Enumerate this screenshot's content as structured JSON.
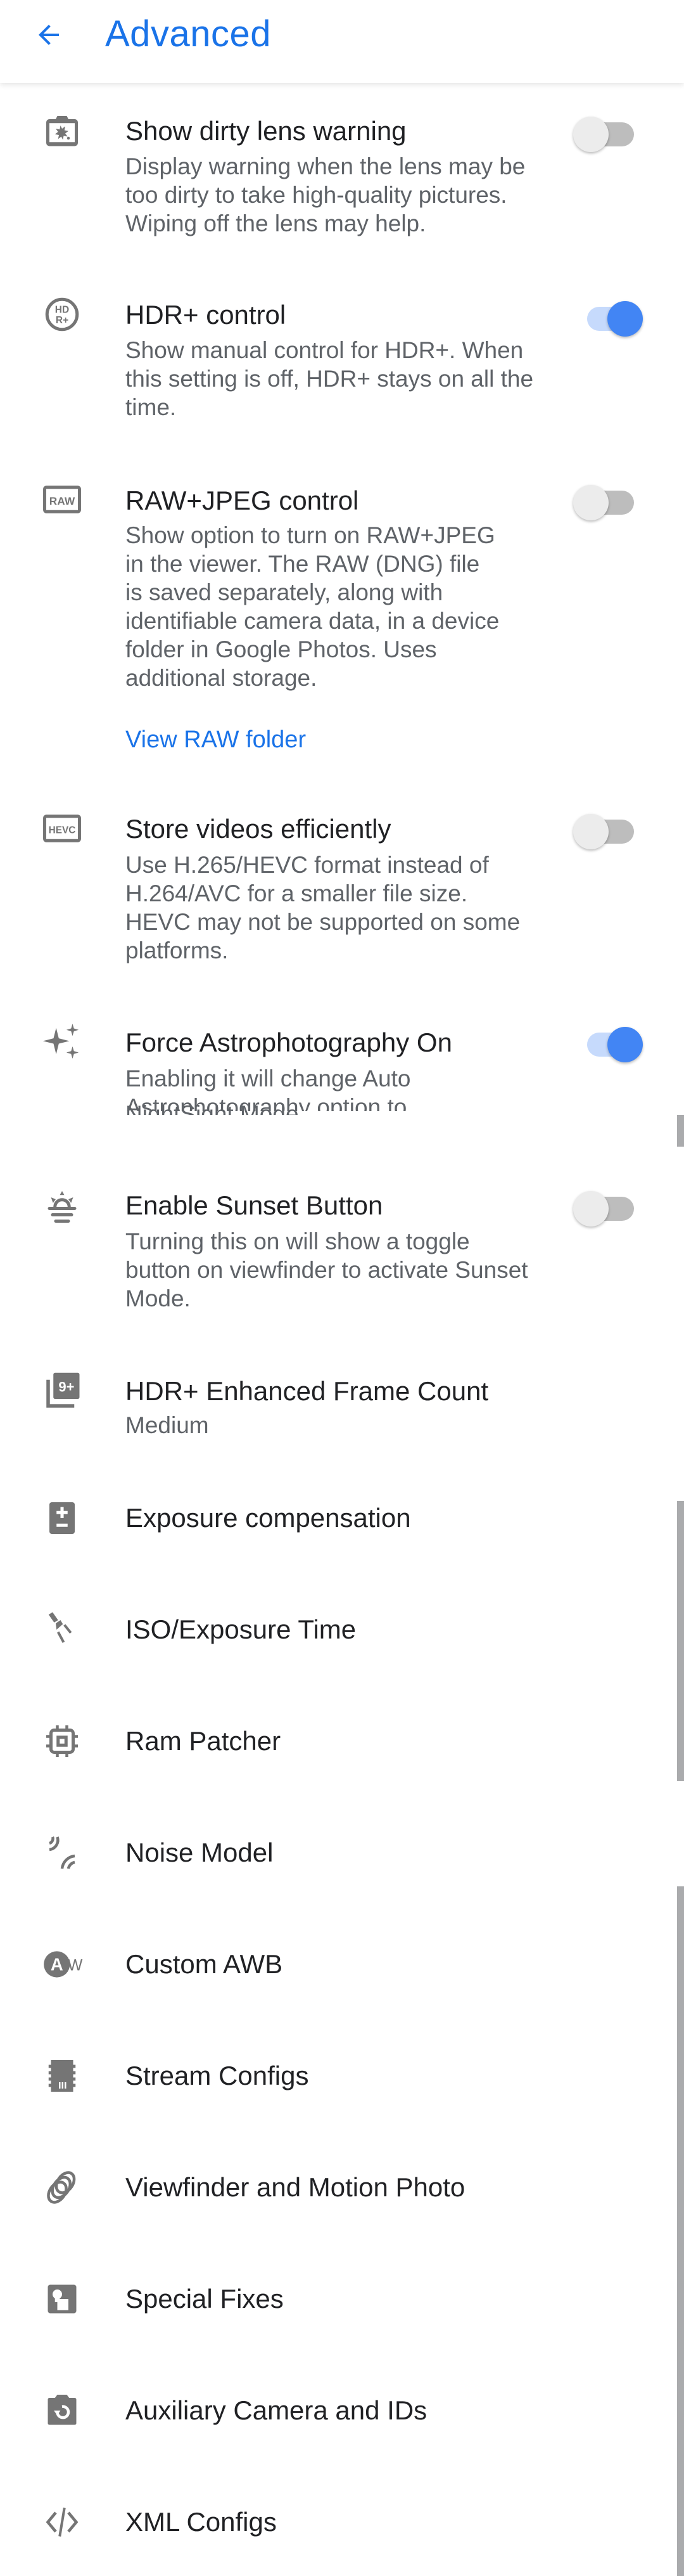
{
  "appbar": {
    "title": "Advanced",
    "back_icon": "arrow-back-icon"
  },
  "colors": {
    "accent": "#1a73e8",
    "switch_on_thumb": "#4285f4",
    "switch_on_track": "#c6dafc",
    "switch_off_thumb": "#ececec",
    "switch_off_track": "#bdbdbd",
    "icon_gray": "#757575",
    "title_text": "#202124",
    "summary_text": "#5f6368"
  },
  "toggles": [
    {
      "icon": "dirty-lens-icon",
      "title": "Show dirty lens warning",
      "summary_lines": [
        "Display warning when the lens may be",
        "too dirty to take high-quality pictures.",
        "Wiping off the lens may help."
      ],
      "checked": false
    },
    {
      "icon": "hdr-plus-icon",
      "title": "HDR+ control",
      "summary_lines": [
        "Show manual control for HDR+. When",
        "this setting is off, HDR+ stays on all the",
        "time."
      ],
      "checked": true
    },
    {
      "icon": "raw-icon",
      "title": "RAW+JPEG control",
      "summary_lines": [
        "Show option to turn on RAW+JPEG",
        "in the viewer. The RAW (DNG) file",
        "is saved separately, along with",
        "identifiable camera data, in a device",
        "folder in Google Photos. Uses",
        "additional storage."
      ],
      "link": "View RAW folder",
      "checked": false
    },
    {
      "icon": "hevc-icon",
      "title": "Store videos efficiently",
      "summary_lines": [
        "Use H.265/HEVC format instead of",
        "H.264/AVC for a smaller file size.",
        "HEVC may not be supported on some",
        "platforms."
      ],
      "checked": false
    },
    {
      "icon": "sparkles-icon",
      "title": "Force Astrophotography On",
      "summary_lines": [
        "Enabling it will change Auto",
        "Astrophotography option to",
        "NightSight Mode."
      ],
      "checked": true
    },
    {
      "icon": "sunset-icon",
      "title": "Enable Sunset Button",
      "summary_lines": [
        "Turning this on will show a toggle",
        "button on viewfinder to activate Sunset",
        "Mode."
      ],
      "checked": false
    }
  ],
  "frame_count": {
    "icon": "filter-9-plus-icon",
    "title": "HDR+ Enhanced Frame Count",
    "value": "Medium"
  },
  "menu_items": [
    {
      "icon": "exposure-icon",
      "label": "Exposure compensation"
    },
    {
      "icon": "iso-exposure-time-icon",
      "label": "ISO/Exposure Time"
    },
    {
      "icon": "memory-chip-icon",
      "label": "Ram Patcher"
    },
    {
      "icon": "noise-waves-icon",
      "label": "Noise Model"
    },
    {
      "icon": "awb-icon",
      "label": "Custom AWB"
    },
    {
      "icon": "stream-chip-icon",
      "label": "Stream Configs"
    },
    {
      "icon": "motion-photo-icon",
      "label": "Viewfinder and Motion Photo"
    },
    {
      "icon": "special-fixes-icon",
      "label": "Special Fixes"
    },
    {
      "icon": "camera-switch-icon",
      "label": "Auxiliary Camera and IDs"
    },
    {
      "icon": "code-icon",
      "label": "XML Configs"
    }
  ]
}
